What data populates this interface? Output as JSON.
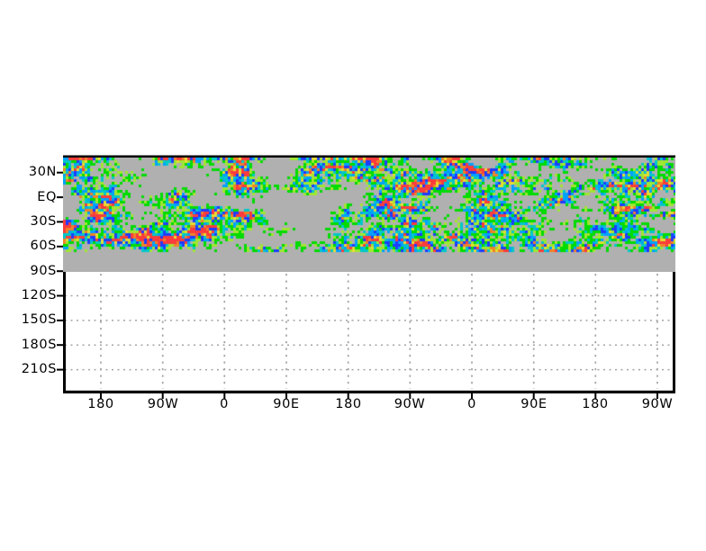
{
  "chart_data": {
    "type": "heatmap",
    "title": "",
    "x_axis": {
      "tick_labels": [
        "180",
        "90W",
        "0",
        "90E",
        "180",
        "90W",
        "0",
        "90E",
        "180",
        "90W"
      ],
      "note": "longitude axis repeats (wrapped domain), ticks every 90 degrees"
    },
    "y_axis": {
      "tick_labels": [
        "30N",
        "EQ",
        "30S",
        "60S",
        "90S",
        "120S",
        "150S",
        "180S",
        "210S"
      ],
      "note": "latitude axis extended beyond pole; ticks every 30 degrees"
    },
    "grid": {
      "style": "dotted",
      "color": "#a4a4a4",
      "shown_only_below_data_band": true
    },
    "frame_color": "#000000",
    "plot_background": "#ffffff",
    "data_band": {
      "background_gray": "#b0b0b0",
      "palette_low_to_high": [
        "#00dc00",
        "#a0e632",
        "#00c8c8",
        "#00a0ff",
        "#1e3cff",
        "#e6dc32",
        "#f08228",
        "#fa3c3c"
      ],
      "coverage_note": "speckled shaded anomaly field from top frame (~50N) down to ~65S; plain gray continues to 90S; blank (white) south of 90S"
    }
  }
}
